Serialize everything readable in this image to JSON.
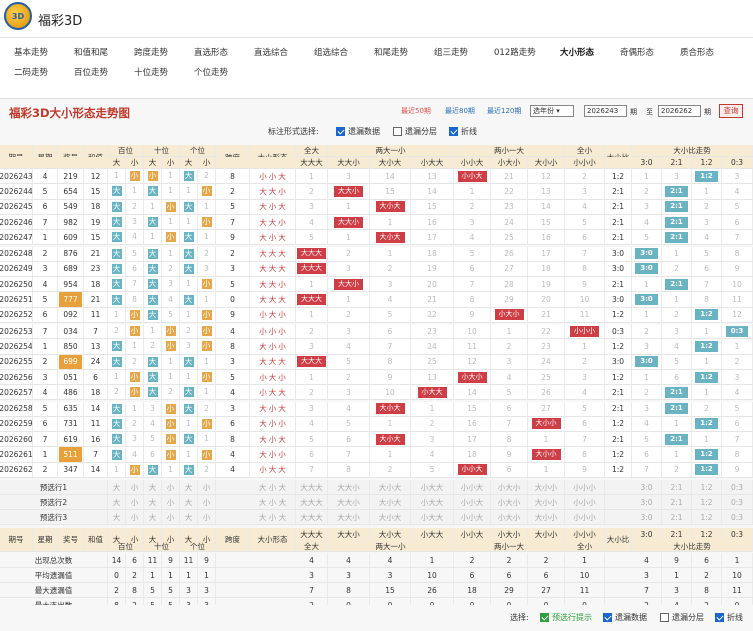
{
  "app": {
    "title": "福彩3D",
    "logo_text": "3D"
  },
  "nav": [
    "基本走势",
    "和值和尾",
    "跨度走势",
    "直选形态",
    "直选综合",
    "组选综合",
    "和尾走势",
    "组三走势",
    "012路走势",
    "大小形态",
    "奇偶形态",
    "质合形态",
    "二码走势",
    "百位走势",
    "十位走势",
    "个位走势"
  ],
  "nav_active": "大小形态",
  "panel": {
    "title": "福彩3D大小形态走势图",
    "recent": [
      "最近50期",
      "最近80期",
      "最近120期"
    ],
    "select": "选年份",
    "from": "2026243",
    "to": "2026262",
    "qi": "期",
    "zhi": "至",
    "query": "查询"
  },
  "options": {
    "label": "标注形式选择:",
    "items": [
      {
        "label": "遗漏数据",
        "checked": true
      },
      {
        "label": "遗漏分层",
        "checked": false
      },
      {
        "label": "折线",
        "checked": true
      }
    ]
  },
  "table_header": {
    "qihao": "期号",
    "xingqi": "星期",
    "jianghao": "奖号",
    "hezhi": "和值",
    "bai": "百位",
    "shi": "十位",
    "ge": "个位",
    "da": "大",
    "xiao": "小",
    "kuadu": "跨度",
    "dxxt": "大小形态",
    "quanda": "全大",
    "dada": "大大大",
    "liangda": "两大一小",
    "ddx": "大大小",
    "dxd": "大小大",
    "xdd": "小大大",
    "liangxiao": "两小一大",
    "xxd": "小小大",
    "xdx": "小大小",
    "dxx": "大小小",
    "quanxiao": "全小",
    "xxx": "小小小",
    "dxb": "大小比",
    "dxbzs": "大小比走势",
    "ratios": [
      "3:0",
      "2:1",
      "1:2",
      "0:3"
    ]
  },
  "rows": [
    {
      "q": "2026243",
      "w": "4",
      "n": "219",
      "s": "12",
      "b": [
        "1",
        "小"
      ],
      "t": [
        "小",
        "1"
      ],
      "g": [
        "大",
        "2"
      ],
      "k": "8",
      "pat": "小小大",
      "pc": [
        "1",
        "3",
        "14",
        "13",
        "小小大",
        "21",
        "12",
        "2"
      ],
      "r": "1:2",
      "rc": [
        "1",
        "3",
        "1:2",
        "3"
      ]
    },
    {
      "q": "2026244",
      "w": "5",
      "n": "654",
      "s": "15",
      "b": [
        "大",
        "1"
      ],
      "t": [
        "大",
        "1"
      ],
      "g": [
        "1",
        "小"
      ],
      "k": "2",
      "pat": "大大小",
      "pc": [
        "2",
        "大大小",
        "15",
        "14",
        "1",
        "22",
        "13",
        "3"
      ],
      "r": "2:1",
      "rc": [
        "2",
        "2:1",
        "1",
        "4"
      ]
    },
    {
      "q": "2026245",
      "w": "6",
      "n": "549",
      "s": "18",
      "b": [
        "大",
        "2"
      ],
      "t": [
        "1",
        "小"
      ],
      "g": [
        "大",
        "1"
      ],
      "k": "5",
      "pat": "大小大",
      "pc": [
        "3",
        "1",
        "大小大",
        "15",
        "2",
        "23",
        "14",
        "4"
      ],
      "r": "2:1",
      "rc": [
        "3",
        "2:1",
        "2",
        "5"
      ]
    },
    {
      "q": "2026246",
      "w": "7",
      "n": "982",
      "s": "19",
      "b": [
        "大",
        "3"
      ],
      "t": [
        "大",
        "1"
      ],
      "g": [
        "1",
        "小"
      ],
      "k": "7",
      "pat": "大大小",
      "pc": [
        "4",
        "大大小",
        "1",
        "16",
        "3",
        "24",
        "15",
        "5"
      ],
      "r": "2:1",
      "rc": [
        "4",
        "2:1",
        "3",
        "6"
      ]
    },
    {
      "q": "2026247",
      "w": "1",
      "n": "609",
      "s": "15",
      "b": [
        "大",
        "4"
      ],
      "t": [
        "1",
        "小"
      ],
      "g": [
        "大",
        "1"
      ],
      "k": "9",
      "pat": "大小大",
      "pc": [
        "5",
        "1",
        "大小大",
        "17",
        "4",
        "25",
        "16",
        "6"
      ],
      "r": "2:1",
      "rc": [
        "5",
        "2:1",
        "4",
        "7"
      ]
    },
    {
      "q": "2026248",
      "w": "2",
      "n": "876",
      "s": "21",
      "b": [
        "大",
        "5"
      ],
      "t": [
        "大",
        "1"
      ],
      "g": [
        "大",
        "2"
      ],
      "k": "2",
      "pat": "大大大",
      "pc": [
        "大大大",
        "2",
        "1",
        "18",
        "5",
        "26",
        "17",
        "7"
      ],
      "r": "3:0",
      "rc": [
        "3:0",
        "1",
        "5",
        "8"
      ]
    },
    {
      "q": "2026249",
      "w": "3",
      "n": "689",
      "s": "23",
      "b": [
        "大",
        "6"
      ],
      "t": [
        "大",
        "2"
      ],
      "g": [
        "大",
        "3"
      ],
      "k": "3",
      "pat": "大大大",
      "pc": [
        "大大大",
        "3",
        "2",
        "19",
        "6",
        "27",
        "18",
        "8"
      ],
      "r": "3:0",
      "rc": [
        "3:0",
        "2",
        "6",
        "9"
      ]
    },
    {
      "q": "2026250",
      "w": "4",
      "n": "954",
      "s": "18",
      "b": [
        "大",
        "7"
      ],
      "t": [
        "大",
        "3"
      ],
      "g": [
        "1",
        "小"
      ],
      "k": "5",
      "pat": "大大小",
      "pc": [
        "1",
        "大大小",
        "3",
        "20",
        "7",
        "28",
        "19",
        "9"
      ],
      "r": "2:1",
      "rc": [
        "1",
        "2:1",
        "7",
        "10"
      ]
    },
    {
      "q": "2026251",
      "w": "5",
      "n": "777",
      "s": "21",
      "b": [
        "大",
        "8"
      ],
      "t": [
        "大",
        "4"
      ],
      "g": [
        "大",
        "1"
      ],
      "k": "0",
      "pat": "大大大",
      "pc": [
        "大大大",
        "1",
        "4",
        "21",
        "8",
        "29",
        "20",
        "10"
      ],
      "r": "3:0",
      "rc": [
        "3:0",
        "1",
        "8",
        "11"
      ]
    },
    {
      "q": "2026252",
      "w": "6",
      "n": "092",
      "s": "11",
      "b": [
        "1",
        "小"
      ],
      "t": [
        "大",
        "5"
      ],
      "g": [
        "1",
        "小"
      ],
      "k": "9",
      "pat": "小大小",
      "pc": [
        "1",
        "2",
        "5",
        "22",
        "9",
        "小大小",
        "21",
        "11"
      ],
      "r": "1:2",
      "rc": [
        "1",
        "2",
        "1:2",
        "12"
      ]
    },
    {
      "q": "2026253",
      "w": "7",
      "n": "034",
      "s": "7",
      "b": [
        "2",
        "小"
      ],
      "t": [
        "1",
        "小"
      ],
      "g": [
        "2",
        "小"
      ],
      "k": "4",
      "pat": "小小小",
      "pc": [
        "2",
        "3",
        "6",
        "23",
        "10",
        "1",
        "22",
        "小小小"
      ],
      "r": "0:3",
      "rc": [
        "2",
        "3",
        "1",
        "0:3"
      ]
    },
    {
      "q": "2026254",
      "w": "1",
      "n": "850",
      "s": "13",
      "b": [
        "大",
        "1"
      ],
      "t": [
        "2",
        "小"
      ],
      "g": [
        "3",
        "小"
      ],
      "k": "8",
      "pat": "大小小",
      "pc": [
        "3",
        "4",
        "7",
        "24",
        "11",
        "2",
        "23",
        "1"
      ],
      "r": "1:2",
      "rc": [
        "3",
        "4",
        "1:2",
        "1"
      ]
    },
    {
      "q": "2026255",
      "w": "2",
      "n": "699",
      "s": "24",
      "b": [
        "大",
        "2"
      ],
      "t": [
        "大",
        "1"
      ],
      "g": [
        "大",
        "1"
      ],
      "k": "3",
      "pat": "大大大",
      "pc": [
        "大大大",
        "5",
        "8",
        "25",
        "12",
        "3",
        "24",
        "2"
      ],
      "r": "3:0",
      "rc": [
        "3:0",
        "5",
        "1",
        "2"
      ]
    },
    {
      "q": "2026256",
      "w": "3",
      "n": "051",
      "s": "6",
      "b": [
        "1",
        "小"
      ],
      "t": [
        "大",
        "1"
      ],
      "g": [
        "1",
        "小"
      ],
      "k": "5",
      "pat": "小大小",
      "pc": [
        "1",
        "2",
        "9",
        "13",
        "小大小",
        "4",
        "25",
        "3"
      ],
      "r": "1:2",
      "rc": [
        "1",
        "6",
        "1:2",
        "3"
      ]
    },
    {
      "q": "2026257",
      "w": "4",
      "n": "486",
      "s": "18",
      "b": [
        "2",
        "小"
      ],
      "t": [
        "大",
        "2"
      ],
      "g": [
        "大",
        "1"
      ],
      "k": "4",
      "pat": "小大大",
      "pc": [
        "2",
        "3",
        "10",
        "小大大",
        "14",
        "5",
        "26",
        "4"
      ],
      "r": "2:1",
      "rc": [
        "2",
        "2:1",
        "1",
        "4"
      ]
    },
    {
      "q": "2026258",
      "w": "5",
      "n": "635",
      "s": "14",
      "b": [
        "大",
        "1"
      ],
      "t": [
        "3",
        "小"
      ],
      "g": [
        "大",
        "2"
      ],
      "k": "3",
      "pat": "大小大",
      "pc": [
        "3",
        "4",
        "大小大",
        "1",
        "15",
        "6",
        "27",
        "5"
      ],
      "r": "2:1",
      "rc": [
        "3",
        "2:1",
        "2",
        "5"
      ]
    },
    {
      "q": "2026259",
      "w": "6",
      "n": "731",
      "s": "11",
      "b": [
        "大",
        "2"
      ],
      "t": [
        "4",
        "小"
      ],
      "g": [
        "1",
        "小"
      ],
      "k": "6",
      "pat": "大小小",
      "pc": [
        "4",
        "5",
        "1",
        "2",
        "16",
        "7",
        "大小小",
        "6"
      ],
      "r": "1:2",
      "rc": [
        "4",
        "1",
        "1:2",
        "6"
      ]
    },
    {
      "q": "2026260",
      "w": "7",
      "n": "619",
      "s": "16",
      "b": [
        "大",
        "3"
      ],
      "t": [
        "5",
        "小"
      ],
      "g": [
        "大",
        "1"
      ],
      "k": "8",
      "pat": "大小大",
      "pc": [
        "5",
        "6",
        "大小大",
        "3",
        "17",
        "8",
        "1",
        "7"
      ],
      "r": "2:1",
      "rc": [
        "5",
        "2:1",
        "1",
        "7"
      ]
    },
    {
      "q": "2026261",
      "w": "1",
      "n": "511",
      "s": "7",
      "b": [
        "大",
        "4"
      ],
      "t": [
        "6",
        "小"
      ],
      "g": [
        "1",
        "小"
      ],
      "k": "4",
      "pat": "大小小",
      "pc": [
        "6",
        "7",
        "1",
        "4",
        "18",
        "9",
        "大小小",
        "8"
      ],
      "r": "1:2",
      "rc": [
        "6",
        "1",
        "1:2",
        "8"
      ]
    },
    {
      "q": "2026262",
      "w": "2",
      "n": "347",
      "s": "14",
      "b": [
        "1",
        "小"
      ],
      "t": [
        "大",
        "1"
      ],
      "g": [
        "大",
        "2"
      ],
      "k": "4",
      "pat": "小大大",
      "pc": [
        "7",
        "8",
        "2",
        "5",
        "小小大",
        "6",
        "1",
        "9"
      ],
      "r": "1:2",
      "rc": [
        "7",
        "2",
        "1:2",
        "9"
      ]
    }
  ],
  "highlight_nums": [
    "777",
    "699",
    "511"
  ],
  "preview": {
    "rows": [
      "预选行1",
      "预选行2",
      "预选行3"
    ],
    "pat_cells": [
      "大",
      "小",
      "大",
      "小",
      "大",
      "小"
    ],
    "pat": "大 小 大",
    "pc": [
      "大大大",
      "大大小",
      "大小大",
      "小大大",
      "小小大",
      "小大小",
      "大小小",
      "小小小"
    ],
    "rc": [
      "3:0",
      "2:1",
      "1:2",
      "0:3"
    ]
  },
  "stats": {
    "labels": [
      "出现总次数",
      "平均遗漏值",
      "最大遗漏值",
      "最大连出数"
    ],
    "bs": [
      [
        "14",
        "6",
        "11",
        "9",
        "11",
        "9"
      ],
      [
        "0",
        "2",
        "1",
        "1",
        "1",
        "1"
      ],
      [
        "2",
        "8",
        "5",
        "5",
        "3",
        "3"
      ],
      [
        "8",
        "2",
        "5",
        "5",
        "3",
        "3"
      ]
    ],
    "pc": [
      [
        "4",
        "4",
        "4",
        "1",
        "2",
        "2",
        "2",
        "1"
      ],
      [
        "3",
        "3",
        "3",
        "10",
        "6",
        "6",
        "6",
        "10"
      ],
      [
        "7",
        "8",
        "15",
        "26",
        "18",
        "29",
        "27",
        "11"
      ],
      [
        "2",
        "0",
        "0",
        "0",
        "0",
        "0",
        "0",
        "0"
      ]
    ],
    "rc": [
      [
        "4",
        "9",
        "6",
        "1"
      ],
      [
        "3",
        "1",
        "2",
        "10"
      ],
      [
        "7",
        "3",
        "8",
        "11"
      ],
      [
        "2",
        "4",
        "2",
        "0"
      ]
    ]
  },
  "footer": {
    "label": "选择:",
    "items": [
      {
        "label": "预选行提示",
        "checked": true,
        "green": true
      },
      {
        "label": "遗漏数据",
        "checked": true
      },
      {
        "label": "遗漏分层",
        "checked": false
      },
      {
        "label": "折线",
        "checked": true
      }
    ]
  }
}
